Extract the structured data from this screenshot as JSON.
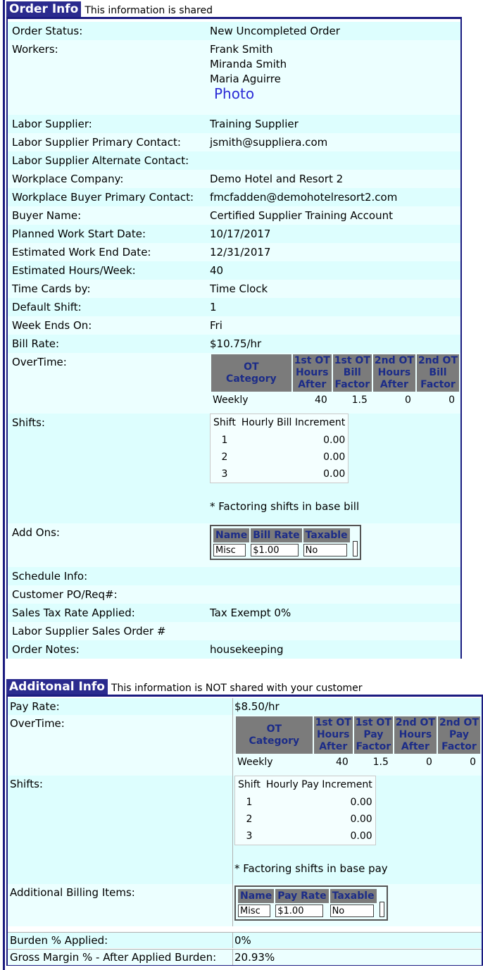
{
  "order": {
    "tab": "Order Info",
    "subtitle": "This information is shared",
    "fields": {
      "order_status": {
        "label": "Order Status:",
        "value": "New Uncompleted Order"
      },
      "workers": {
        "label": "Workers:",
        "values": [
          "Frank Smith",
          "Miranda Smith",
          "Maria Aguirre"
        ],
        "photo": "Photo"
      },
      "labor_supplier": {
        "label": "Labor Supplier:",
        "value": "Training Supplier"
      },
      "ls_primary": {
        "label": "Labor Supplier Primary Contact:",
        "value": "jsmith@suppliera.com"
      },
      "ls_alternate": {
        "label": "Labor Supplier Alternate Contact:",
        "value": ""
      },
      "workplace_company": {
        "label": "Workplace Company:",
        "value": "Demo Hotel and Resort 2"
      },
      "wb_primary": {
        "label": "Workplace Buyer Primary Contact:",
        "value": "fmcfadden@demohotelresort2.com"
      },
      "buyer_name": {
        "label": "Buyer Name:",
        "value": "Certified Supplier Training Account"
      },
      "start_date": {
        "label": "Planned Work Start Date:",
        "value": "10/17/2017"
      },
      "end_date": {
        "label": "Estimated Work End Date:",
        "value": "12/31/2017"
      },
      "hours_week": {
        "label": "Estimated Hours/Week:",
        "value": "40"
      },
      "time_cards": {
        "label": "Time Cards by:",
        "value": "Time Clock"
      },
      "default_shift": {
        "label": "Default Shift:",
        "value": "1"
      },
      "week_ends": {
        "label": "Week Ends On:",
        "value": "Fri"
      },
      "bill_rate": {
        "label": "Bill Rate:",
        "value": "$10.75/hr"
      },
      "overtime": {
        "label": "OverTime:"
      },
      "shifts": {
        "label": "Shifts:"
      },
      "add_ons": {
        "label": "Add Ons:"
      },
      "schedule": {
        "label": "Schedule Info:",
        "value": ""
      },
      "customer_po": {
        "label": "Customer PO/Req#:",
        "value": ""
      },
      "sales_tax": {
        "label": "Sales Tax Rate Applied:",
        "value": "Tax Exempt 0%"
      },
      "ls_sales_order": {
        "label": "Labor Supplier Sales Order #",
        "value": ""
      },
      "order_notes": {
        "label": "Order Notes:",
        "value": "housekeeping"
      }
    },
    "ot_table": {
      "headers": [
        [
          "OT",
          "Category"
        ],
        [
          "1st OT",
          "Hours",
          "After"
        ],
        [
          "1st OT",
          "Bill",
          "Factor"
        ],
        [
          "2nd OT",
          "Hours",
          "After"
        ],
        [
          "2nd OT",
          "Bill",
          "Factor"
        ]
      ],
      "row": [
        "Weekly",
        "40",
        "1.5",
        "0",
        "0"
      ]
    },
    "shift_table": {
      "headers": [
        "Shift",
        "Hourly Bill Increment"
      ],
      "rows": [
        [
          "1",
          "0.00"
        ],
        [
          "2",
          "0.00"
        ],
        [
          "3",
          "0.00"
        ]
      ],
      "note": "* Factoring shifts in base bill"
    },
    "addon_table": {
      "headers": [
        "Name",
        "Bill Rate",
        "Taxable"
      ],
      "row": [
        "Misc",
        "$1.00",
        "No"
      ]
    }
  },
  "additional": {
    "tab": "Additonal Info",
    "subtitle": "This information is NOT shared with your customer",
    "fields": {
      "pay_rate": {
        "label": "Pay Rate:",
        "value": "$8.50/hr"
      },
      "overtime": {
        "label": "OverTime:"
      },
      "shifts": {
        "label": "Shifts:"
      },
      "billing_items": {
        "label": "Additional Billing Items:"
      },
      "burden": {
        "label": "Burden % Applied:",
        "value": "0%"
      },
      "gross_margin": {
        "label": "Gross Margin % - After Applied Burden:",
        "value": "20.93%"
      }
    },
    "ot_table": {
      "headers": [
        [
          "OT",
          "Category"
        ],
        [
          "1st OT",
          "Hours",
          "After"
        ],
        [
          "1st OT",
          "Pay",
          "Factor"
        ],
        [
          "2nd OT",
          "Hours",
          "After"
        ],
        [
          "2nd OT",
          "Pay",
          "Factor"
        ]
      ],
      "row": [
        "Weekly",
        "40",
        "1.5",
        "0",
        "0"
      ]
    },
    "shift_table": {
      "headers": [
        "Shift",
        "Hourly Pay Increment"
      ],
      "rows": [
        [
          "1",
          "0.00"
        ],
        [
          "2",
          "0.00"
        ],
        [
          "3",
          "0.00"
        ]
      ],
      "note": "* Factoring shifts in base pay"
    },
    "billing_table": {
      "headers": [
        "Name",
        "Pay Rate",
        "Taxable"
      ],
      "row": [
        "Misc",
        "$1.00",
        "No"
      ]
    }
  }
}
